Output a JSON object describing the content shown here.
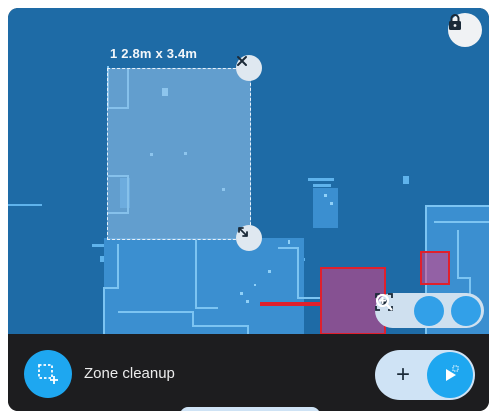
{
  "map": {
    "zone": {
      "dimensions_label": "1 2.8m x 3.4m"
    },
    "icons": {
      "lock": "lock-icon",
      "remove_zone": "close-icon",
      "resize_zone": "resize-icon",
      "recenter": "focus-icon",
      "zoom_out": "zoom-out-icon",
      "zoom_in": "zoom-in-icon"
    },
    "colors": {
      "floor": "#1e6ba6",
      "walls": "#5fb3ec",
      "zone_fill": "#8cbee6",
      "no_go": "#e0202c",
      "accent": "#1ea7f0"
    }
  },
  "bottom_bar": {
    "mode_label": "Zone cleanup",
    "mode_icon": "zone-select-icon",
    "add_label": "+",
    "start_icon": "play-icon"
  }
}
